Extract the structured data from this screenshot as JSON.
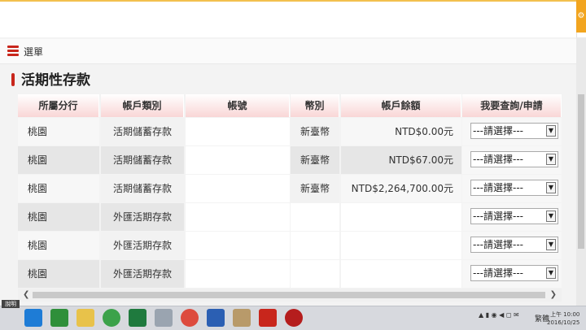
{
  "menu": {
    "label": "選單"
  },
  "section": {
    "title": "活期性存款"
  },
  "table": {
    "headers": [
      "所屬分行",
      "帳戶類別",
      "帳號",
      "幣別",
      "帳戶餘額",
      "我要查詢/申請"
    ],
    "rows": [
      {
        "branch": "桃園",
        "type": "活期儲蓄存款",
        "account": "",
        "currency": "新臺幣",
        "balance": "NTD$0.00元",
        "action": "---請選擇---"
      },
      {
        "branch": "桃園",
        "type": "活期儲蓄存款",
        "account": "",
        "currency": "新臺幣",
        "balance": "NTD$67.00元",
        "action": "---請選擇---"
      },
      {
        "branch": "桃園",
        "type": "活期儲蓄存款",
        "account": "",
        "currency": "新臺幣",
        "balance": "NTD$2,264,700.00元",
        "action": "---請選擇---"
      },
      {
        "branch": "桃園",
        "type": "外匯活期存款",
        "account": "",
        "currency": "",
        "balance": "",
        "action": "---請選擇---"
      },
      {
        "branch": "桃園",
        "type": "外匯活期存款",
        "account": "",
        "currency": "",
        "balance": "",
        "action": "---請選擇---"
      },
      {
        "branch": "桃園",
        "type": "外匯活期存款",
        "account": "",
        "currency": "",
        "balance": "",
        "action": "---請選擇---"
      }
    ]
  },
  "taskbar": {
    "start_label": "說明",
    "lang": "繁體",
    "time": "上午 10:00",
    "date": "2016/10/25"
  },
  "colors": {
    "accent": "#c8261c",
    "header_gradient": "#f9d6d6",
    "corner": "#f2a51f"
  },
  "icons": [
    "ie-icon",
    "calculator-icon",
    "file-explorer-icon",
    "green-arrow-icon",
    "excel-icon",
    "chrome-icon",
    "word-icon",
    "bank-icon"
  ]
}
